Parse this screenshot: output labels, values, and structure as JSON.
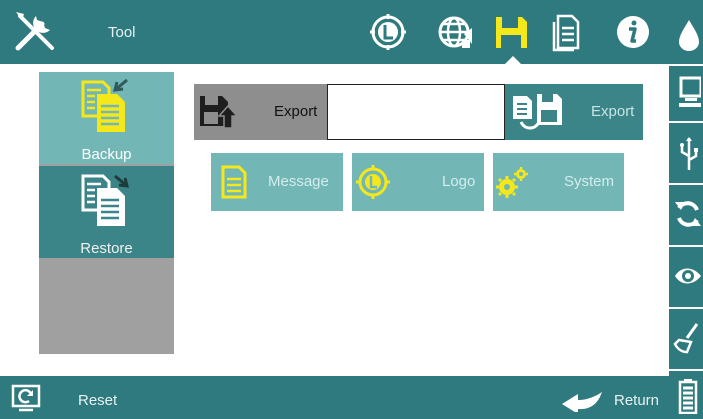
{
  "colors": {
    "bar": "#2e7a7e",
    "tile_light": "#72b6b6",
    "tile_dark": "#3b8488",
    "accent_yellow": "#f4e81a",
    "panel_gray": "#a0a0a0"
  },
  "topbar": {
    "title": "Tool",
    "icons": [
      "tools-icon",
      "logo-icon",
      "globe-icon",
      "save-icon",
      "document-icon",
      "info-icon"
    ],
    "active": "save-icon"
  },
  "rightbar": {
    "icons": [
      "ink-drop-icon",
      "monitor-icon",
      "usb-icon",
      "refresh-icon",
      "eye-icon",
      "clean-brush-icon",
      "battery-icon"
    ]
  },
  "leftpanel": {
    "items": [
      {
        "label": "Backup",
        "icon": "backup-icon",
        "selected": true
      },
      {
        "label": "Restore",
        "icon": "restore-icon",
        "selected": false
      }
    ]
  },
  "export": {
    "left_label": "Export",
    "input_value": "",
    "input_placeholder": "",
    "right_label": "Export"
  },
  "categories": [
    {
      "label": "Message",
      "icon": "message-icon"
    },
    {
      "label": "Logo",
      "icon": "logo-icon"
    },
    {
      "label": "System",
      "icon": "gears-icon"
    }
  ],
  "bottombar": {
    "reset_label": "Reset",
    "return_label": "Return"
  }
}
